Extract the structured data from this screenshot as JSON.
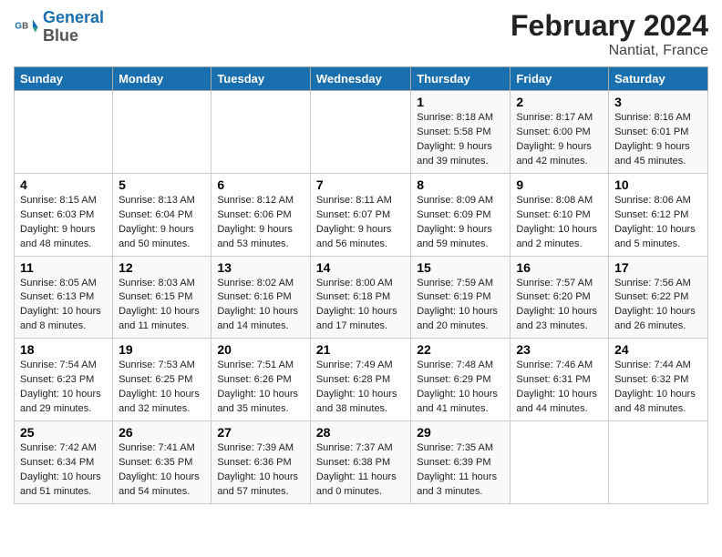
{
  "header": {
    "logo_line1": "General",
    "logo_line2": "Blue",
    "title": "February 2024",
    "subtitle": "Nantiat, France"
  },
  "columns": [
    "Sunday",
    "Monday",
    "Tuesday",
    "Wednesday",
    "Thursday",
    "Friday",
    "Saturday"
  ],
  "weeks": [
    [
      {
        "day": "",
        "info": ""
      },
      {
        "day": "",
        "info": ""
      },
      {
        "day": "",
        "info": ""
      },
      {
        "day": "",
        "info": ""
      },
      {
        "day": "1",
        "info": "Sunrise: 8:18 AM\nSunset: 5:58 PM\nDaylight: 9 hours\nand 39 minutes."
      },
      {
        "day": "2",
        "info": "Sunrise: 8:17 AM\nSunset: 6:00 PM\nDaylight: 9 hours\nand 42 minutes."
      },
      {
        "day": "3",
        "info": "Sunrise: 8:16 AM\nSunset: 6:01 PM\nDaylight: 9 hours\nand 45 minutes."
      }
    ],
    [
      {
        "day": "4",
        "info": "Sunrise: 8:15 AM\nSunset: 6:03 PM\nDaylight: 9 hours\nand 48 minutes."
      },
      {
        "day": "5",
        "info": "Sunrise: 8:13 AM\nSunset: 6:04 PM\nDaylight: 9 hours\nand 50 minutes."
      },
      {
        "day": "6",
        "info": "Sunrise: 8:12 AM\nSunset: 6:06 PM\nDaylight: 9 hours\nand 53 minutes."
      },
      {
        "day": "7",
        "info": "Sunrise: 8:11 AM\nSunset: 6:07 PM\nDaylight: 9 hours\nand 56 minutes."
      },
      {
        "day": "8",
        "info": "Sunrise: 8:09 AM\nSunset: 6:09 PM\nDaylight: 9 hours\nand 59 minutes."
      },
      {
        "day": "9",
        "info": "Sunrise: 8:08 AM\nSunset: 6:10 PM\nDaylight: 10 hours\nand 2 minutes."
      },
      {
        "day": "10",
        "info": "Sunrise: 8:06 AM\nSunset: 6:12 PM\nDaylight: 10 hours\nand 5 minutes."
      }
    ],
    [
      {
        "day": "11",
        "info": "Sunrise: 8:05 AM\nSunset: 6:13 PM\nDaylight: 10 hours\nand 8 minutes."
      },
      {
        "day": "12",
        "info": "Sunrise: 8:03 AM\nSunset: 6:15 PM\nDaylight: 10 hours\nand 11 minutes."
      },
      {
        "day": "13",
        "info": "Sunrise: 8:02 AM\nSunset: 6:16 PM\nDaylight: 10 hours\nand 14 minutes."
      },
      {
        "day": "14",
        "info": "Sunrise: 8:00 AM\nSunset: 6:18 PM\nDaylight: 10 hours\nand 17 minutes."
      },
      {
        "day": "15",
        "info": "Sunrise: 7:59 AM\nSunset: 6:19 PM\nDaylight: 10 hours\nand 20 minutes."
      },
      {
        "day": "16",
        "info": "Sunrise: 7:57 AM\nSunset: 6:20 PM\nDaylight: 10 hours\nand 23 minutes."
      },
      {
        "day": "17",
        "info": "Sunrise: 7:56 AM\nSunset: 6:22 PM\nDaylight: 10 hours\nand 26 minutes."
      }
    ],
    [
      {
        "day": "18",
        "info": "Sunrise: 7:54 AM\nSunset: 6:23 PM\nDaylight: 10 hours\nand 29 minutes."
      },
      {
        "day": "19",
        "info": "Sunrise: 7:53 AM\nSunset: 6:25 PM\nDaylight: 10 hours\nand 32 minutes."
      },
      {
        "day": "20",
        "info": "Sunrise: 7:51 AM\nSunset: 6:26 PM\nDaylight: 10 hours\nand 35 minutes."
      },
      {
        "day": "21",
        "info": "Sunrise: 7:49 AM\nSunset: 6:28 PM\nDaylight: 10 hours\nand 38 minutes."
      },
      {
        "day": "22",
        "info": "Sunrise: 7:48 AM\nSunset: 6:29 PM\nDaylight: 10 hours\nand 41 minutes."
      },
      {
        "day": "23",
        "info": "Sunrise: 7:46 AM\nSunset: 6:31 PM\nDaylight: 10 hours\nand 44 minutes."
      },
      {
        "day": "24",
        "info": "Sunrise: 7:44 AM\nSunset: 6:32 PM\nDaylight: 10 hours\nand 48 minutes."
      }
    ],
    [
      {
        "day": "25",
        "info": "Sunrise: 7:42 AM\nSunset: 6:34 PM\nDaylight: 10 hours\nand 51 minutes."
      },
      {
        "day": "26",
        "info": "Sunrise: 7:41 AM\nSunset: 6:35 PM\nDaylight: 10 hours\nand 54 minutes."
      },
      {
        "day": "27",
        "info": "Sunrise: 7:39 AM\nSunset: 6:36 PM\nDaylight: 10 hours\nand 57 minutes."
      },
      {
        "day": "28",
        "info": "Sunrise: 7:37 AM\nSunset: 6:38 PM\nDaylight: 11 hours\nand 0 minutes."
      },
      {
        "day": "29",
        "info": "Sunrise: 7:35 AM\nSunset: 6:39 PM\nDaylight: 11 hours\nand 3 minutes."
      },
      {
        "day": "",
        "info": ""
      },
      {
        "day": "",
        "info": ""
      }
    ]
  ]
}
